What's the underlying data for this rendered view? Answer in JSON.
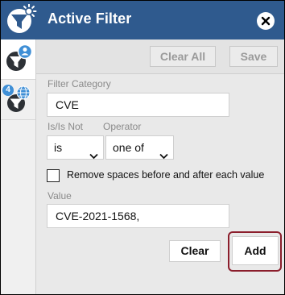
{
  "header": {
    "title": "Active Filter"
  },
  "icons": {
    "app": "filter-settings-icon",
    "close": "close-icon",
    "tab_user": "filter-user-icon",
    "tab_global": "filter-globe-icon"
  },
  "sidebar": {
    "global_badge": "4"
  },
  "toolbar": {
    "clear_all": "Clear All",
    "save": "Save"
  },
  "form": {
    "filter_category_label": "Filter Category",
    "filter_category_value": "CVE",
    "is_label": "Is/Is Not",
    "is_value": "is",
    "operator_label": "Operator",
    "operator_value": "one of",
    "remove_spaces_label": "Remove spaces before and after each value",
    "remove_spaces_checked": false,
    "value_label": "Value",
    "value_text": "CVE-2021-1568,"
  },
  "actions": {
    "clear": "Clear",
    "add": "Add"
  },
  "colors": {
    "header": "#2f5a8e",
    "icon_dark": "#2d3136",
    "badge": "#3f8fd6",
    "highlight": "#8b1e2c"
  }
}
